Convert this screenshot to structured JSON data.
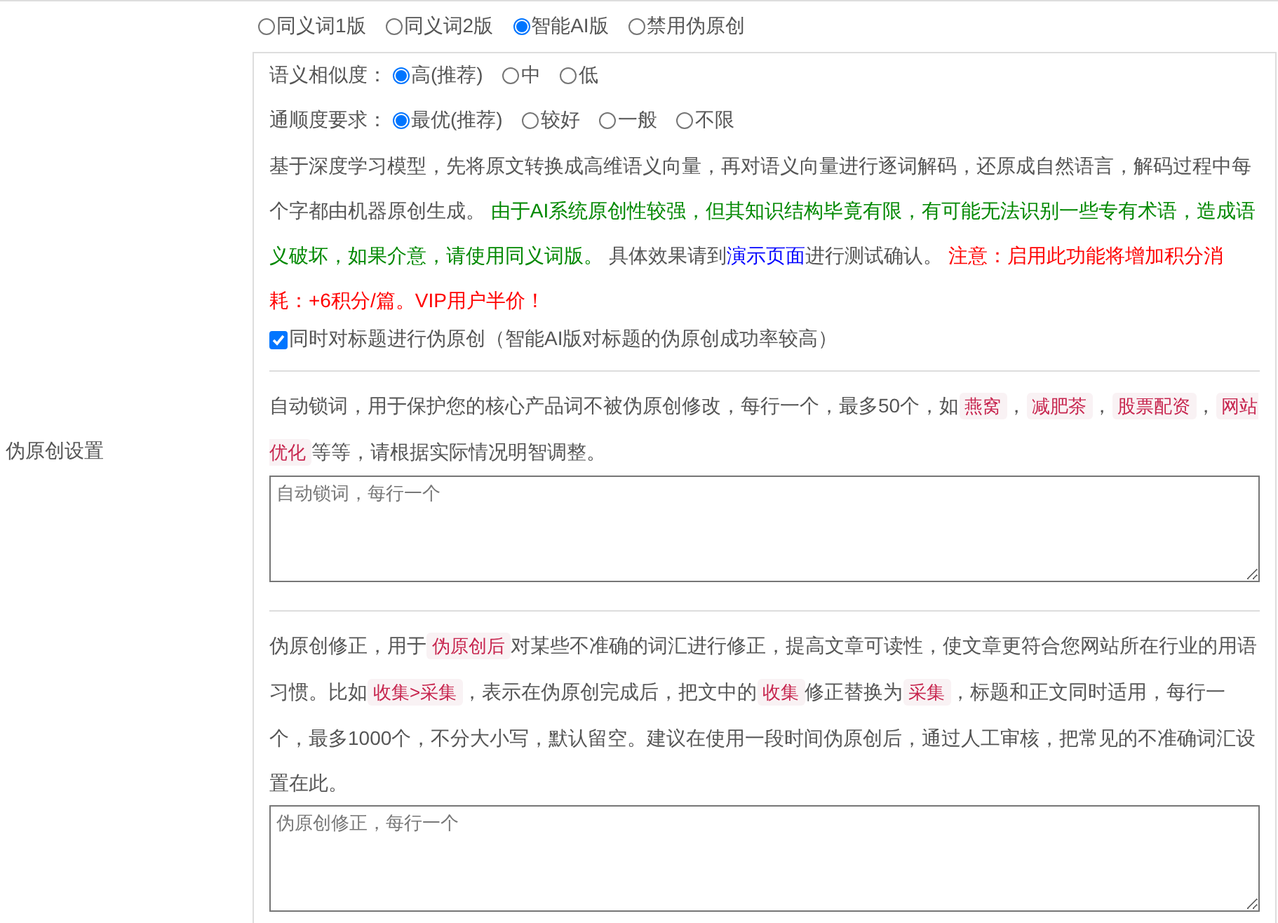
{
  "mode_options": [
    {
      "label": "同义词1版",
      "selected": false
    },
    {
      "label": "同义词2版",
      "selected": false
    },
    {
      "label": "智能AI版",
      "selected": true
    },
    {
      "label": "禁用伪原创",
      "selected": false
    }
  ],
  "similarity": {
    "label": "语义相似度：",
    "options": [
      {
        "label": "高(推荐)",
        "selected": true
      },
      {
        "label": "中",
        "selected": false
      },
      {
        "label": "低",
        "selected": false
      }
    ]
  },
  "fluency": {
    "label": "通顺度要求：",
    "options": [
      {
        "label": "最优(推荐)",
        "selected": true
      },
      {
        "label": "较好",
        "selected": false
      },
      {
        "label": "一般",
        "selected": false
      },
      {
        "label": "不限",
        "selected": false
      }
    ]
  },
  "ai_description": [
    {
      "kind": "text",
      "text": "基于深度学习模型，先将原文转换成高维语义向量，再对语义向量进行逐词解码，还原成自然语言，解码过程中每个字都由机器原创生成。 "
    },
    {
      "kind": "notice",
      "text": "由于AI系统原创性较强，但其知识结构毕竟有限，有可能无法识别一些专有术语，造成语义破坏，如果介意，请使用同义词版。"
    },
    {
      "kind": "text",
      "text": " 具体效果请到"
    },
    {
      "kind": "link",
      "text": "演示页面"
    },
    {
      "kind": "text",
      "text": "进行测试确认。 "
    },
    {
      "kind": "warning",
      "text": "注意：启用此功能将增加积分消耗：+6积分/篇。VIP用户半价！"
    }
  ],
  "title_rewrite": {
    "label": "同时对标题进行伪原创（智能AI版对标题的伪原创成功率较高）",
    "checked": true
  },
  "side_label": "伪原创设置",
  "lock_words": {
    "description": [
      {
        "kind": "text",
        "text": "自动锁词，用于保护您的核心产品词不被伪原创修改，每行一个，最多50个，如"
      },
      {
        "kind": "code",
        "text": "燕窝"
      },
      {
        "kind": "text",
        "text": "，"
      },
      {
        "kind": "code",
        "text": "减肥茶"
      },
      {
        "kind": "text",
        "text": "，"
      },
      {
        "kind": "code",
        "text": "股票配资"
      },
      {
        "kind": "text",
        "text": "，"
      },
      {
        "kind": "code",
        "text": "网站优化"
      },
      {
        "kind": "text",
        "text": "等等，请根据实际情况明智调整。"
      }
    ],
    "placeholder": "自动锁词，每行一个"
  },
  "corrections": {
    "description": [
      {
        "kind": "text",
        "text": "伪原创修正，用于"
      },
      {
        "kind": "code",
        "text": "伪原创后"
      },
      {
        "kind": "text",
        "text": "对某些不准确的词汇进行修正，提高文章可读性，使文章更符合您网站所在行业的用语习惯。比如"
      },
      {
        "kind": "code",
        "text": "收集>采集"
      },
      {
        "kind": "text",
        "text": "，表示在伪原创完成后，把文中的"
      },
      {
        "kind": "code",
        "text": "收集"
      },
      {
        "kind": "text",
        "text": "修正替换为"
      },
      {
        "kind": "code",
        "text": "采集"
      },
      {
        "kind": "text",
        "text": "，标题和正文同时适用，每行一个，最多1000个，不分大小写，默认留空。建议在使用一段时间伪原创后，通过人工审核，把常见的不准确词汇设置在此。"
      }
    ],
    "placeholder": "伪原创修正，每行一个"
  }
}
